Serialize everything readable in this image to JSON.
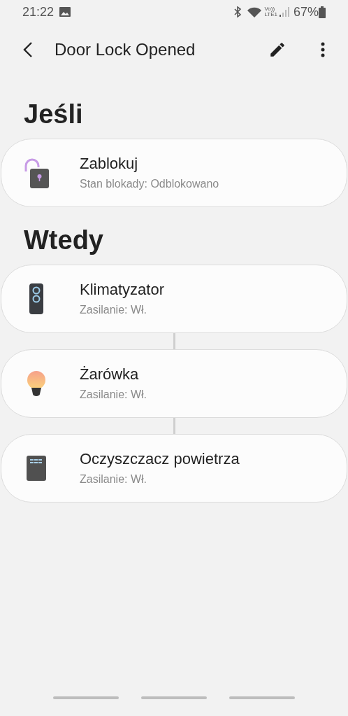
{
  "status_bar": {
    "time": "21:22",
    "network_labels": [
      "Vo))",
      "LTE1"
    ],
    "battery": "67%"
  },
  "top_bar": {
    "title": "Door Lock Opened"
  },
  "if_section": {
    "heading": "Jeśli",
    "items": [
      {
        "kind": "lock",
        "name": "Zablokuj",
        "detail": "Stan blokady: Odblokowano"
      }
    ]
  },
  "then_section": {
    "heading": "Wtedy",
    "items": [
      {
        "kind": "remote",
        "name": "Klimatyzator",
        "detail": "Zasilanie: Wł."
      },
      {
        "kind": "bulb",
        "name": "Żarówka",
        "detail": "Zasilanie: Wł."
      },
      {
        "kind": "purifier",
        "name": "Oczyszczacz powietrza",
        "detail": "Zasilanie: Wł."
      }
    ]
  }
}
